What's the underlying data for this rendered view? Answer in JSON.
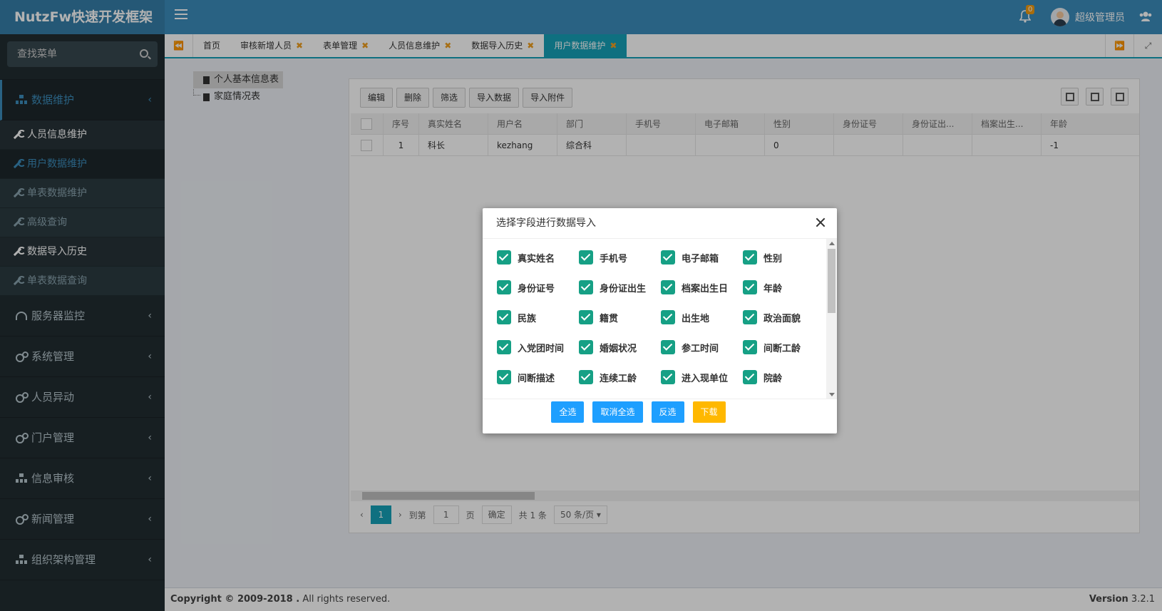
{
  "app": {
    "title": "NutzFw快速开发框架"
  },
  "header": {
    "notification_count": "0",
    "user_name": "超级管理员"
  },
  "sidebar": {
    "search_placeholder": "查找菜单",
    "active_group": "数据维护",
    "sub_items": [
      "人员信息维护",
      "用户数据维护",
      "单表数据维护",
      "高级查询",
      "数据导入历史",
      "单表数据查询"
    ],
    "groups": [
      "服务器监控",
      "系统管理",
      "人员异动",
      "门户管理",
      "信息审核",
      "新闻管理",
      "组织架构管理"
    ]
  },
  "tabs": [
    "首页",
    "审核新增人员",
    "表单管理",
    "人员信息维护",
    "数据导入历史",
    "用户数据维护"
  ],
  "tree": [
    "个人基本信息表",
    "家庭情况表"
  ],
  "toolbar": [
    "编辑",
    "删除",
    "筛选",
    "导入数据",
    "导入附件"
  ],
  "table": {
    "columns": [
      "序号",
      "真实姓名",
      "用户名",
      "部门",
      "手机号",
      "电子邮箱",
      "性别",
      "身份证号",
      "身份证出...",
      "档案出生...",
      "年龄"
    ],
    "rows": [
      [
        "1",
        "科长",
        "kezhang",
        "综合科",
        "",
        "",
        "0",
        "",
        "",
        "",
        "-1"
      ]
    ]
  },
  "pager": {
    "current": "1",
    "goto_label": "到第",
    "page_input": "1",
    "page_unit": "页",
    "confirm": "确定",
    "total": "共 1 条",
    "page_size": "50 条/页"
  },
  "dialog": {
    "title": "选择字段进行数据导入",
    "fields": [
      "真实姓名",
      "手机号",
      "电子邮箱",
      "性别",
      "身份证号",
      "身份证出生",
      "档案出生日",
      "年龄",
      "民族",
      "籍贯",
      "出生地",
      "政治面貌",
      "入党团时间",
      "婚姻状况",
      "参工时间",
      "间断工龄",
      "间断描述",
      "连续工龄",
      "进入现单位",
      "院龄"
    ],
    "buttons": {
      "select_all": "全选",
      "deselect_all": "取消全选",
      "invert": "反选",
      "download": "下载"
    }
  },
  "footer": {
    "copyright": "Copyright © 2009-2018 .",
    "rights": "All rights reserved.",
    "version_label": "Version",
    "version": "3.2.1"
  },
  "colors": {
    "header": "#3c8dbc",
    "sidebar": "#222d32",
    "accent": "#16a1b8",
    "checkbox": "#16a085",
    "warn": "#ffb800"
  }
}
